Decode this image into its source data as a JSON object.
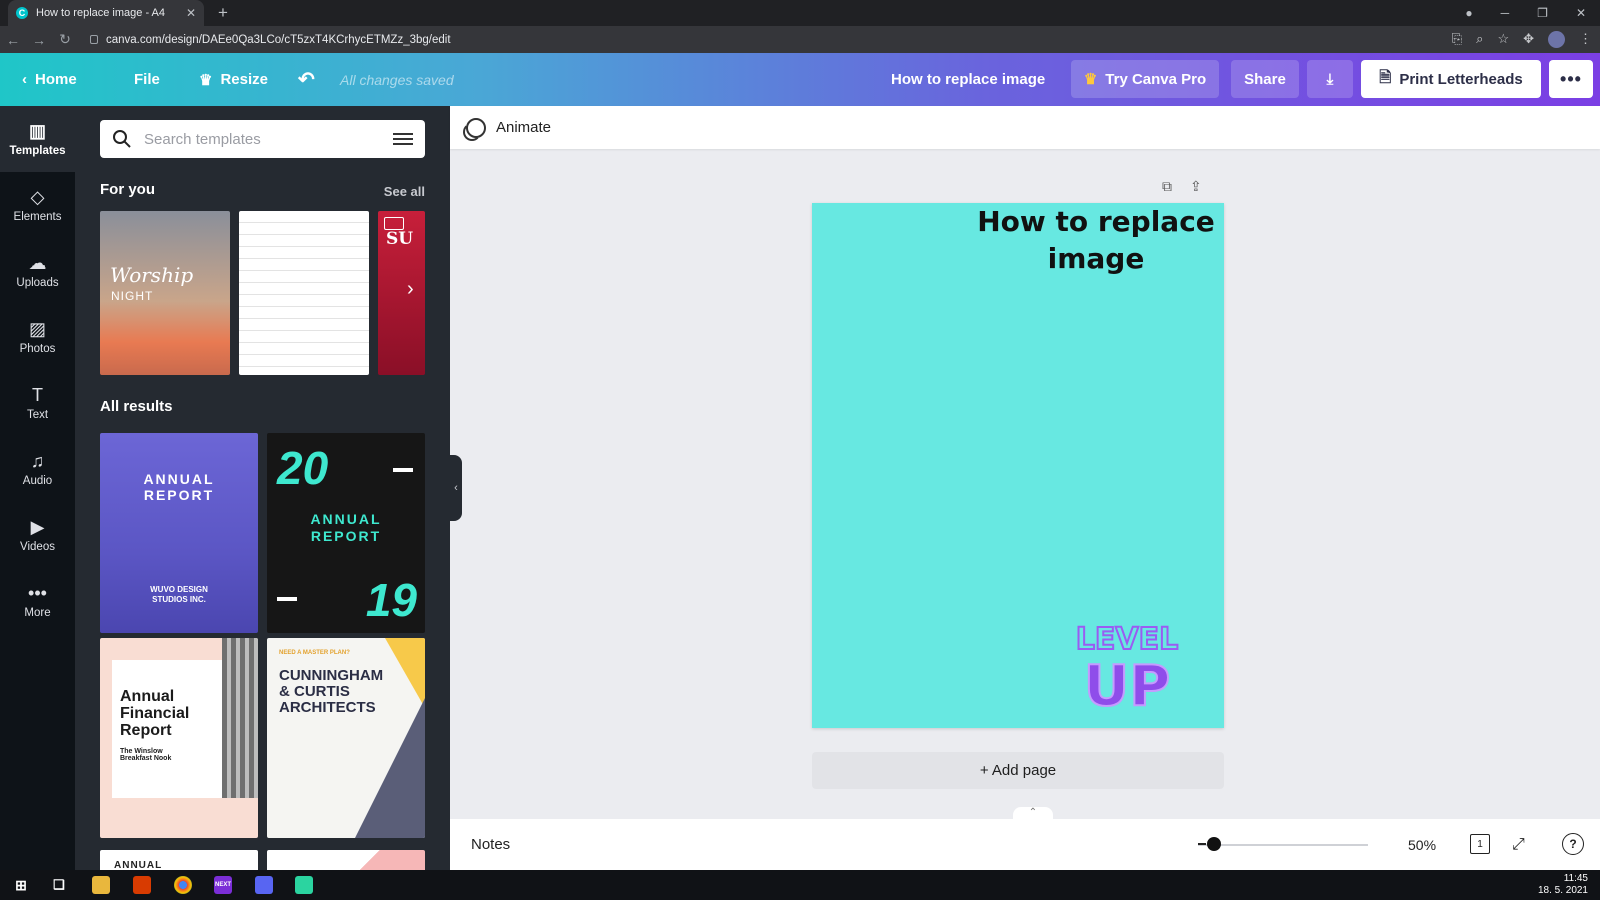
{
  "browser": {
    "tab_title": "How to replace image - A4",
    "tab_favicon": "C",
    "url": "canva.com/design/DAEe0Qa3LCo/cT5zxT4KCrhycETMZz_3bg/edit"
  },
  "header": {
    "home_label": "Home",
    "file_label": "File",
    "resize_label": "Resize",
    "status": "All changes saved",
    "doc_title": "How to replace image",
    "pro_label": "Try Canva Pro",
    "share_label": "Share",
    "print_label": "Print Letterheads",
    "more_label": "•••"
  },
  "rail": {
    "items": [
      {
        "label": "Templates",
        "icon": "templates-icon",
        "glyph": "▥"
      },
      {
        "label": "Elements",
        "icon": "elements-icon",
        "glyph": "◇"
      },
      {
        "label": "Uploads",
        "icon": "uploads-icon",
        "glyph": "☁"
      },
      {
        "label": "Photos",
        "icon": "photos-icon",
        "glyph": "▨"
      },
      {
        "label": "Text",
        "icon": "text-icon",
        "glyph": "T"
      },
      {
        "label": "Audio",
        "icon": "audio-icon",
        "glyph": "♫"
      },
      {
        "label": "Videos",
        "icon": "videos-icon",
        "glyph": "▶"
      },
      {
        "label": "More",
        "icon": "more-icon",
        "glyph": "•••"
      }
    ]
  },
  "panel": {
    "search_placeholder": "Search templates",
    "for_you": "For you",
    "see_all": "See all",
    "all_results": "All results",
    "templates": {
      "worship_title": "Worship",
      "worship_sub": "NIGHT",
      "red_partial": "SU",
      "annual1": "ANNUAL\nREPORT",
      "annual1_sub": "WUVO DESIGN\nSTUDIOS INC.",
      "annual2_top": "20",
      "annual2_title": "ANNUAL\nREPORT",
      "annual2_bottom": "19",
      "finance_title": "Annual\nFinancial\nReport",
      "finance_sub": "The Winslow\nBreakfast Nook",
      "arch_tag": "NEED A MASTER PLAN?",
      "arch_title": "CUNNINGHAM\n& CURTIS\nARCHITECTS",
      "peek_label": "ANNUAL"
    }
  },
  "editor": {
    "animate_label": "Animate",
    "page_heading": "How to replace image",
    "logo_line1": "LEVEL",
    "logo_line2": "UP",
    "add_page": "+ Add page",
    "notes_label": "Notes",
    "zoom": "50%",
    "zoom_fraction": 0.05,
    "page_count": "1",
    "page_color": "#67e8e1"
  },
  "taskbar": {
    "time": "11:45",
    "date": "18. 5. 2021"
  },
  "colors": {
    "header_start": "#1fc6c8",
    "header_end": "#7b3fe4",
    "panel_bg": "#252a31",
    "rail_bg": "#0e1318"
  }
}
